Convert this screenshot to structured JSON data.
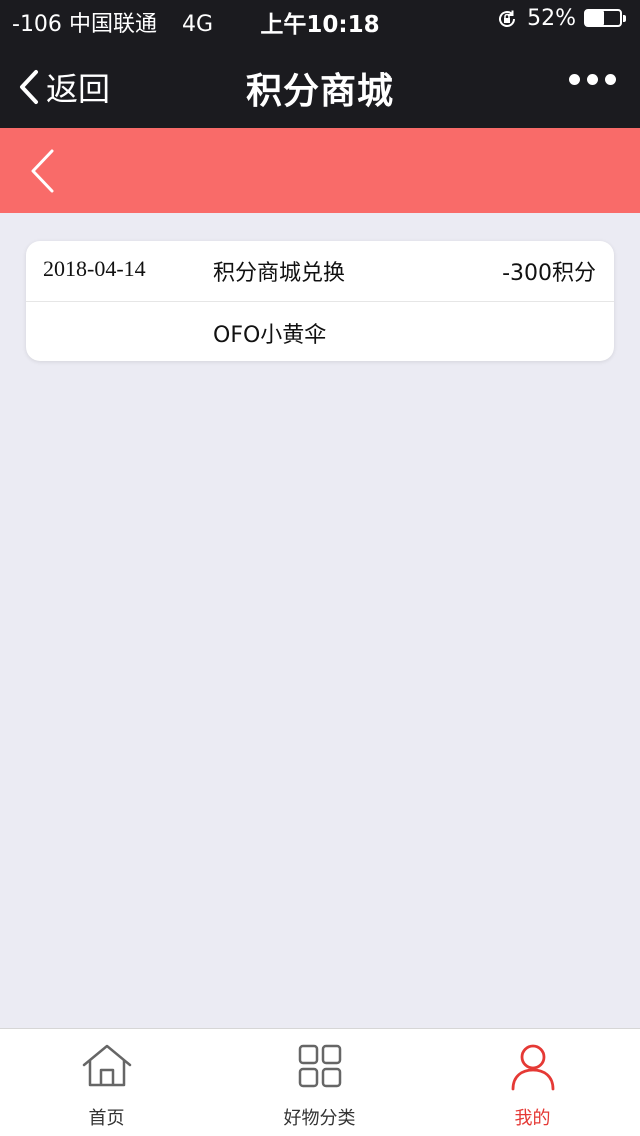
{
  "status_bar": {
    "signal": "-106",
    "carrier": "中国联通",
    "network": "4G",
    "time": "上午10:18",
    "battery_percent": "52%",
    "battery_level": 0.52,
    "icons": [
      "rotation-lock-icon",
      "battery-icon"
    ]
  },
  "nav": {
    "back_label": "返回",
    "title": "积分商城",
    "more_icon": "more-dots-icon"
  },
  "header": {
    "back_icon": "chevron-left-icon",
    "color": "#f96b69"
  },
  "records": [
    {
      "date": "2018-04-14",
      "description": "积分商城兑换",
      "points": "-300积分",
      "item": "OFO小黄伞"
    }
  ],
  "tabs": [
    {
      "label": "首页",
      "icon": "home-icon",
      "active": false
    },
    {
      "label": "好物分类",
      "icon": "grid-icon",
      "active": false
    },
    {
      "label": "我的",
      "icon": "user-icon",
      "active": true
    }
  ],
  "colors": {
    "dark_bar": "#1b1b1f",
    "accent_red": "#e53935",
    "page_bg": "#ebebf3"
  }
}
